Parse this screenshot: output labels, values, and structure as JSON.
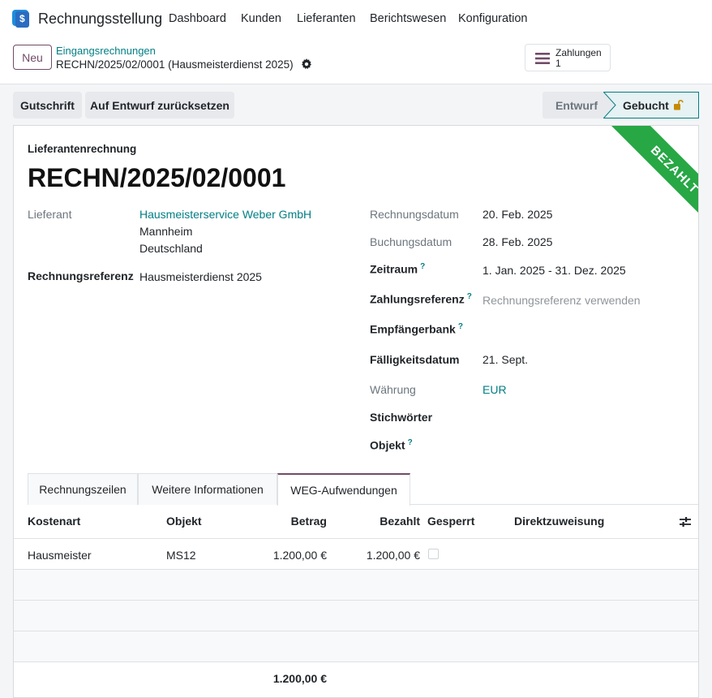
{
  "app": {
    "name": "Rechnungsstellung",
    "menu": [
      "Dashboard",
      "Kunden",
      "Lieferanten",
      "Berichtswesen",
      "Konfiguration"
    ],
    "brand_color": "#714b67",
    "link_color": "#017e84"
  },
  "control_panel": {
    "new_label": "Neu",
    "breadcrumb_parent": "Eingangsrechnungen",
    "breadcrumb_current": "RECHN/2025/02/0001 (Hausmeisterdienst 2025)",
    "payments_label": "Zahlungen",
    "payments_count": "1"
  },
  "actions": {
    "credit_note": "Gutschrift",
    "reset_draft": "Auf Entwurf zurücksetzen",
    "status_draft": "Entwurf",
    "status_posted": "Gebucht"
  },
  "ribbon": {
    "label": "BEZAHLT",
    "color": "#28a745"
  },
  "document": {
    "type": "Lieferantenrechnung",
    "name": "RECHN/2025/02/0001"
  },
  "fields_left": {
    "vendor_label": "Lieferant",
    "vendor_name": "Hausmeisterservice Weber GmbH",
    "vendor_city": "Mannheim",
    "vendor_country": "Deutschland",
    "ref_label": "Rechnungsreferenz",
    "ref_value": "Hausmeisterdienst 2025"
  },
  "fields_right": {
    "invoice_date_label": "Rechnungsdatum",
    "invoice_date": "20. Feb. 2025",
    "accounting_date_label": "Buchungsdatum",
    "accounting_date": "28. Feb. 2025",
    "period_label": "Zeitraum",
    "period": "1. Jan. 2025 - 31. Dez. 2025",
    "payment_ref_label": "Zahlungsreferenz",
    "payment_ref_placeholder": "Rechnungsreferenz verwenden",
    "bank_label": "Empfängerbank",
    "due_label": "Fälligkeitsdatum",
    "due_value": "21. Sept.",
    "currency_label": "Währung",
    "currency": "EUR",
    "tags_label": "Stichwörter",
    "object_label": "Objekt",
    "help_mark": "?"
  },
  "tabs": [
    "Rechnungszeilen",
    "Weitere Informationen",
    "WEG-Aufwendungen"
  ],
  "table": {
    "headers": [
      "Kostenart",
      "Objekt",
      "Betrag",
      "Bezahlt",
      "Gesperrt",
      "Direktzuweisung"
    ],
    "rows": [
      {
        "cost_type": "Hausmeister",
        "object": "MS12",
        "amount": "1.200,00 €",
        "paid": "1.200,00 €",
        "locked": false,
        "direct": ""
      }
    ],
    "total_amount": "1.200,00 €"
  }
}
